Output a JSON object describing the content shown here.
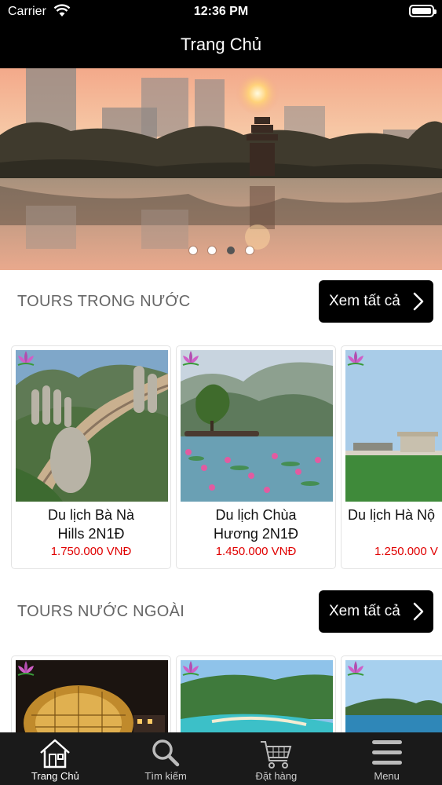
{
  "status_bar": {
    "carrier": "Carrier",
    "time": "12:36 PM"
  },
  "nav": {
    "title": "Trang Chủ"
  },
  "banner": {
    "page_count": 4,
    "active_page": 4
  },
  "domestic": {
    "title": "TOURS TRONG NƯỚC",
    "see_all": "Xem tất cả",
    "tours": [
      {
        "name": "Du lịch Bà Nà Hills 2N1Đ",
        "price": "1.750.000 VNĐ"
      },
      {
        "name": "Du lịch Chùa Hương 2N1Đ",
        "price": "1.450.000 VNĐ"
      },
      {
        "name": "Du lịch Hà Nộ",
        "price": "1.250.000 V"
      }
    ]
  },
  "foreign": {
    "title": "TOURS NƯỚC NGOÀI",
    "see_all": "Xem tất cả"
  },
  "tabbar": {
    "items": [
      {
        "label": "Trang Chủ",
        "icon": "home-icon"
      },
      {
        "label": "Tìm kiếm",
        "icon": "search-icon"
      },
      {
        "label": "Đặt hàng",
        "icon": "cart-icon"
      },
      {
        "label": "Menu",
        "icon": "menu-icon"
      }
    ]
  },
  "colors": {
    "accent": "#000000",
    "price": "#e00000"
  }
}
